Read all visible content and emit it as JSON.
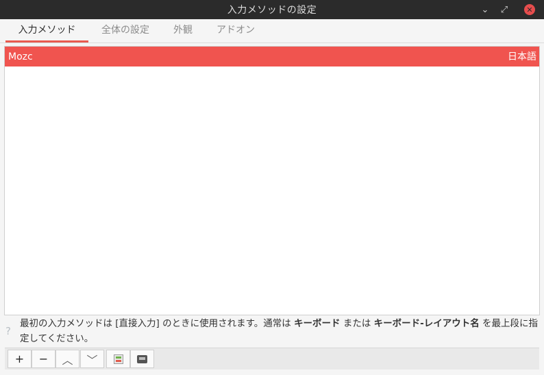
{
  "window": {
    "title": "入力メソッドの設定",
    "min_glyph": "⌄",
    "max_glyph": "⤢",
    "close_glyph": "✕"
  },
  "tabs": [
    {
      "label": "入力メソッド",
      "active": true
    },
    {
      "label": "全体の設定",
      "active": false
    },
    {
      "label": "外観",
      "active": false
    },
    {
      "label": "アドオン",
      "active": false
    }
  ],
  "input_methods": [
    {
      "name": "Mozc",
      "language": "日本語",
      "selected": true
    }
  ],
  "help": {
    "icon": "?",
    "part1": "最初の入力メソッドは [直接入力] のときに使用されます。通常は ",
    "bold1": "キーボード",
    "part2": " または ",
    "bold2": "キーボード-レイアウト名",
    "part3": " を最上段に指定してください。"
  },
  "toolbar": {
    "add": "+",
    "remove": "−",
    "up": "︿",
    "down": "﹀"
  },
  "colors": {
    "accent": "#e85a4f",
    "selection": "#f0544f",
    "titlebar": "#2b2b2b"
  }
}
